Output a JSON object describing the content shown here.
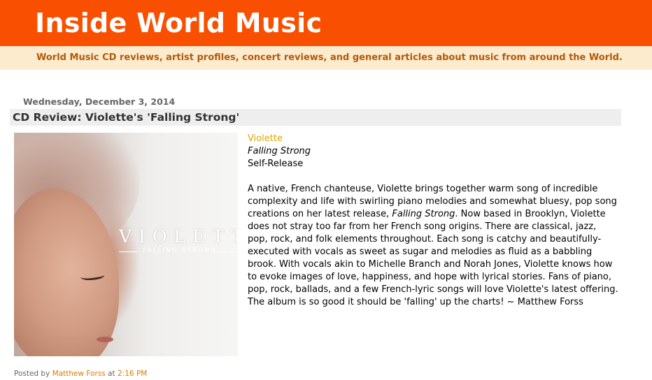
{
  "blog": {
    "title": "Inside World Music",
    "description": "World Music CD reviews, artist profiles, concert reviews, and general articles about music from around the World."
  },
  "post": {
    "date": "Wednesday, December 3, 2014",
    "title": "CD Review: Violette's 'Falling Strong'",
    "cover": {
      "artist_text": "VIOLETTE",
      "album_text": "FALLING STRONG"
    },
    "artist": "Violette",
    "album": "Falling Strong",
    "label": "Self-Release",
    "review_part1": "A native, French chanteuse, Violette brings together warm song of incredible complexity and life with swirling piano melodies and somewhat bluesy, pop song creations on her latest release, ",
    "review_album": "Falling Strong",
    "review_part2": ". Now based in Brooklyn, Violette does not stray too far from her French song origins. There are classical, jazz, pop, rock, and folk elements throughout. Each song is catchy and beautifully-executed with vocals as sweet as sugar and melodies as fluid as a babbling brook. With vocals akin to Michelle Branch and Norah Jones, Violette knows how to evoke images of love, happiness, and hope with lyrical stories. Fans of piano, pop, rock, ballads, and a few French-lyric songs will love Violette's latest offering. The album is so good it should be 'falling' up the charts! ~ Matthew Forss",
    "footer": {
      "posted_by": "Posted by",
      "author": "Matthew Forss",
      "at": "at",
      "time": "2:16 PM"
    }
  },
  "colors": {
    "header_bg": "#f85000",
    "description_bg": "#fdebcd",
    "description_text": "#b05a0c",
    "link": "#e2a100"
  }
}
